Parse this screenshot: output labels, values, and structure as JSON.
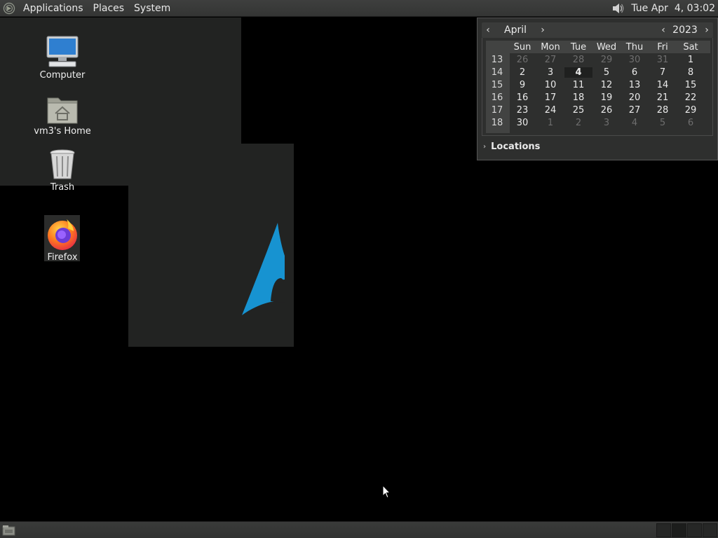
{
  "top_panel": {
    "menus": [
      "Applications",
      "Places",
      "System"
    ],
    "clock": "Tue Apr  4, 03:02"
  },
  "desktop": {
    "icons": [
      {
        "label": "Computer"
      },
      {
        "label": "vm3's Home"
      },
      {
        "label": "Trash"
      },
      {
        "label": "Firefox"
      }
    ]
  },
  "calendar": {
    "month": "April",
    "year": "2023",
    "weekday_headers": [
      "Sun",
      "Mon",
      "Tue",
      "Wed",
      "Thu",
      "Fri",
      "Sat"
    ],
    "weeks": [
      {
        "num": "13",
        "days": [
          "26",
          "27",
          "28",
          "29",
          "30",
          "31",
          "1"
        ]
      },
      {
        "num": "14",
        "days": [
          "2",
          "3",
          "4",
          "5",
          "6",
          "7",
          "8"
        ]
      },
      {
        "num": "15",
        "days": [
          "9",
          "10",
          "11",
          "12",
          "13",
          "14",
          "15"
        ]
      },
      {
        "num": "16",
        "days": [
          "16",
          "17",
          "18",
          "19",
          "20",
          "21",
          "22"
        ]
      },
      {
        "num": "17",
        "days": [
          "23",
          "24",
          "25",
          "26",
          "27",
          "28",
          "29"
        ]
      },
      {
        "num": "18",
        "days": [
          "30",
          "1",
          "2",
          "3",
          "4",
          "5",
          "6"
        ]
      }
    ],
    "today": "4",
    "locations_label": "Locations"
  },
  "colors": {
    "arch_blue": "#1793d1",
    "panel": "#3a3b3a"
  }
}
